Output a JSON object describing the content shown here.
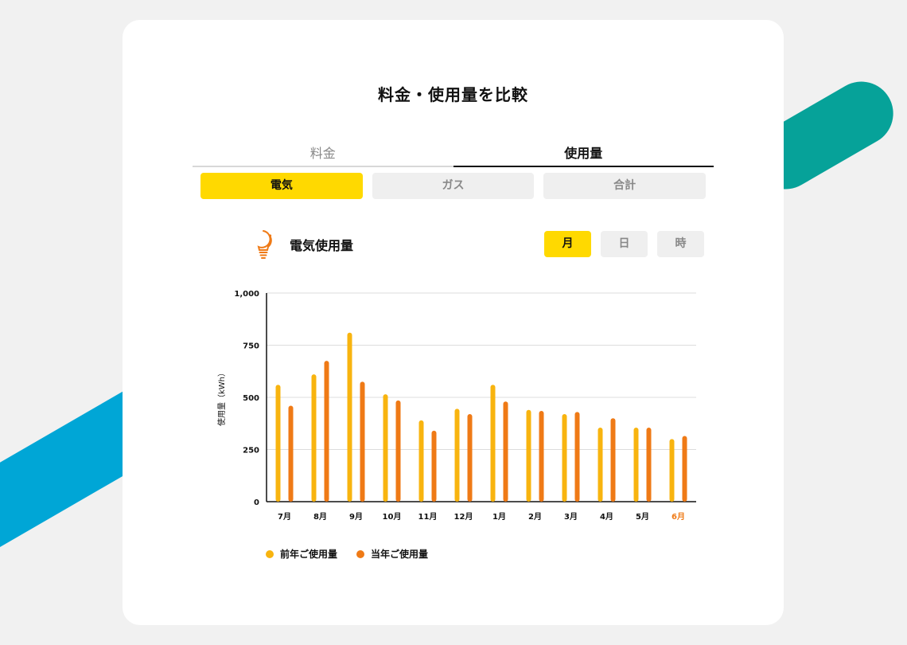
{
  "title": "料金・使用量を比較",
  "tabs": [
    {
      "label": "料金",
      "active": false
    },
    {
      "label": "使用量",
      "active": true
    }
  ],
  "energy_types": [
    {
      "label": "電気",
      "active": true
    },
    {
      "label": "ガス",
      "active": false
    },
    {
      "label": "合計",
      "active": false
    }
  ],
  "usage_title": "電気使用量",
  "icons": {
    "usage": "lightbulb-icon"
  },
  "periods": [
    {
      "label": "月",
      "active": true
    },
    {
      "label": "日",
      "active": false
    },
    {
      "label": "時",
      "active": false
    }
  ],
  "colors": {
    "accent": "#ffd900",
    "previous": "#f8b40f",
    "current": "#ef7a16",
    "current_month_label": "#ef7a16",
    "stripe_blue": "#00a6d6",
    "stripe_teal": "#06a299"
  },
  "legend": {
    "previous": "前年ご使用量",
    "current": "当年ご使用量"
  },
  "chart_data": {
    "type": "bar",
    "ylabel": "使用量（kWh）",
    "xlabel": "",
    "ylim": [
      0,
      1000
    ],
    "yticks": [
      0,
      250,
      500,
      750,
      1000
    ],
    "ytick_labels": [
      "0",
      "250",
      "500",
      "750",
      "1,000"
    ],
    "grid": true,
    "legend_position": "bottom-left",
    "highlighted_category": "6月",
    "categories": [
      "7月",
      "8月",
      "9月",
      "10月",
      "11月",
      "12月",
      "1月",
      "2月",
      "3月",
      "4月",
      "5月",
      "6月"
    ],
    "series": [
      {
        "name": "前年ご使用量",
        "values": [
          560,
          610,
          810,
          515,
          390,
          445,
          560,
          440,
          420,
          355,
          355,
          300
        ]
      },
      {
        "name": "当年ご使用量",
        "values": [
          460,
          675,
          575,
          485,
          340,
          420,
          480,
          435,
          430,
          400,
          355,
          315
        ]
      }
    ]
  }
}
